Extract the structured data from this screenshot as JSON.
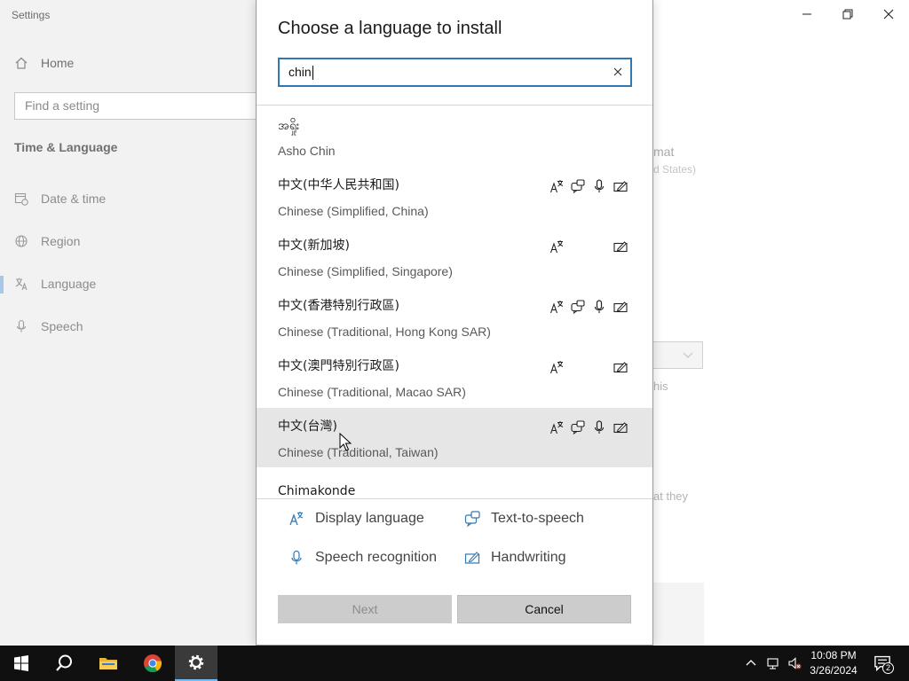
{
  "settings": {
    "window_title": "Settings",
    "home_label": "Home",
    "search_placeholder": "Find a setting",
    "section_title": "Time & Language",
    "nav_items": [
      {
        "label": "Date & time",
        "icon": "calendar-clock-icon"
      },
      {
        "label": "Region",
        "icon": "globe-icon"
      },
      {
        "label": "Language",
        "icon": "language-icon",
        "active": true
      },
      {
        "label": "Speech",
        "icon": "microphone-icon"
      }
    ],
    "bg_fragments": {
      "format": "mat",
      "format_sub": "d States)",
      "this": "his",
      "they": "at they"
    }
  },
  "dialog": {
    "title": "Choose a language to install",
    "search_value": "chin",
    "languages": [
      {
        "native": "အရှိုး",
        "english": "Asho Chin",
        "features": []
      },
      {
        "native": "中文(中华人民共和国)",
        "english": "Chinese (Simplified, China)",
        "features": [
          "display",
          "tts",
          "speech",
          "handwriting"
        ]
      },
      {
        "native": "中文(新加坡)",
        "english": "Chinese (Simplified, Singapore)",
        "features": [
          "display",
          "handwriting"
        ]
      },
      {
        "native": "中文(香港特別行政區)",
        "english": "Chinese (Traditional, Hong Kong SAR)",
        "features": [
          "display",
          "tts",
          "speech",
          "handwriting"
        ]
      },
      {
        "native": "中文(澳門特別行政區)",
        "english": "Chinese (Traditional, Macao SAR)",
        "features": [
          "display",
          "handwriting"
        ]
      },
      {
        "native": "中文(台灣)",
        "english": "Chinese (Traditional, Taiwan)",
        "features": [
          "display",
          "tts",
          "speech",
          "handwriting"
        ],
        "hovered": true
      },
      {
        "native": "Chimakonde",
        "english": "",
        "features": []
      }
    ],
    "legend": {
      "display": "Display language",
      "tts": "Text-to-speech",
      "speech": "Speech recognition",
      "handwriting": "Handwriting"
    },
    "next_label": "Next",
    "cancel_label": "Cancel"
  },
  "taskbar": {
    "time": "10:08 PM",
    "date": "3/26/2024",
    "notification_count": "2"
  },
  "colors": {
    "accent": "#2f78b6",
    "taskbar": "#101010",
    "hover_row": "#e6e6e6"
  }
}
